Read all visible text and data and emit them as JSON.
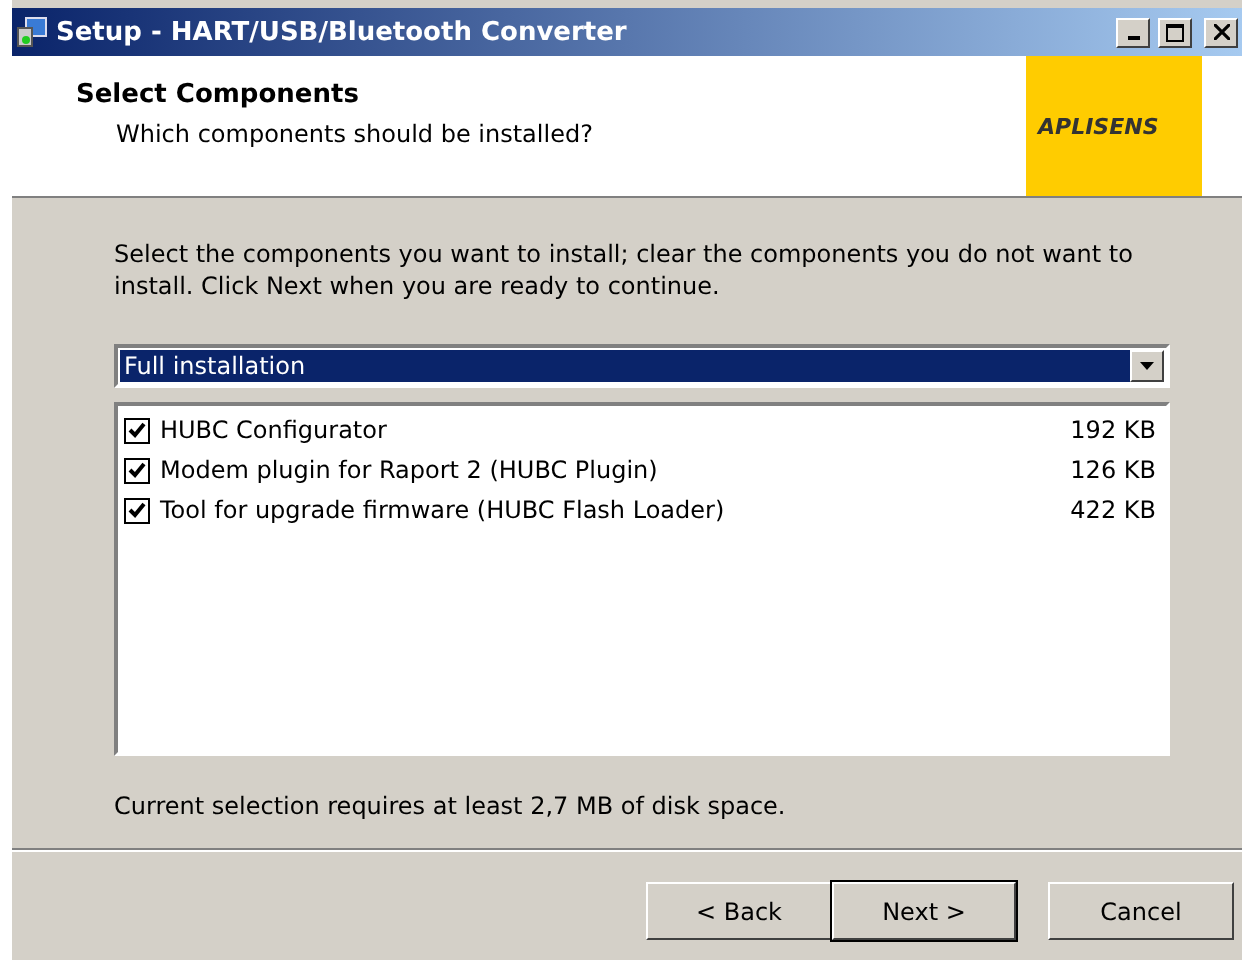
{
  "window": {
    "title": "Setup - HART/USB/Bluetooth Converter"
  },
  "header": {
    "title": "Select Components",
    "subtitle": "Which components should be installed?",
    "logo": "APLISENS"
  },
  "description": "Select the components you want to install; clear the components you do not want to install. Click Next when you are ready to continue.",
  "install_type": {
    "value": "Full installation"
  },
  "components": [
    {
      "name": "HUBC Configurator",
      "size": "192 KB",
      "checked": true
    },
    {
      "name": "Modem plugin for Raport 2 (HUBC Plugin)",
      "size": "126 KB",
      "checked": true
    },
    {
      "name": "Tool for upgrade firmware (HUBC Flash Loader)",
      "size": "422 KB",
      "checked": true
    }
  ],
  "disk_space": "Current selection requires at least 2,7 MB of disk space.",
  "buttons": [
    {
      "label": "< Back",
      "default": false
    },
    {
      "label": "Next >",
      "default": true
    },
    {
      "label": "Cancel",
      "default": false
    }
  ]
}
